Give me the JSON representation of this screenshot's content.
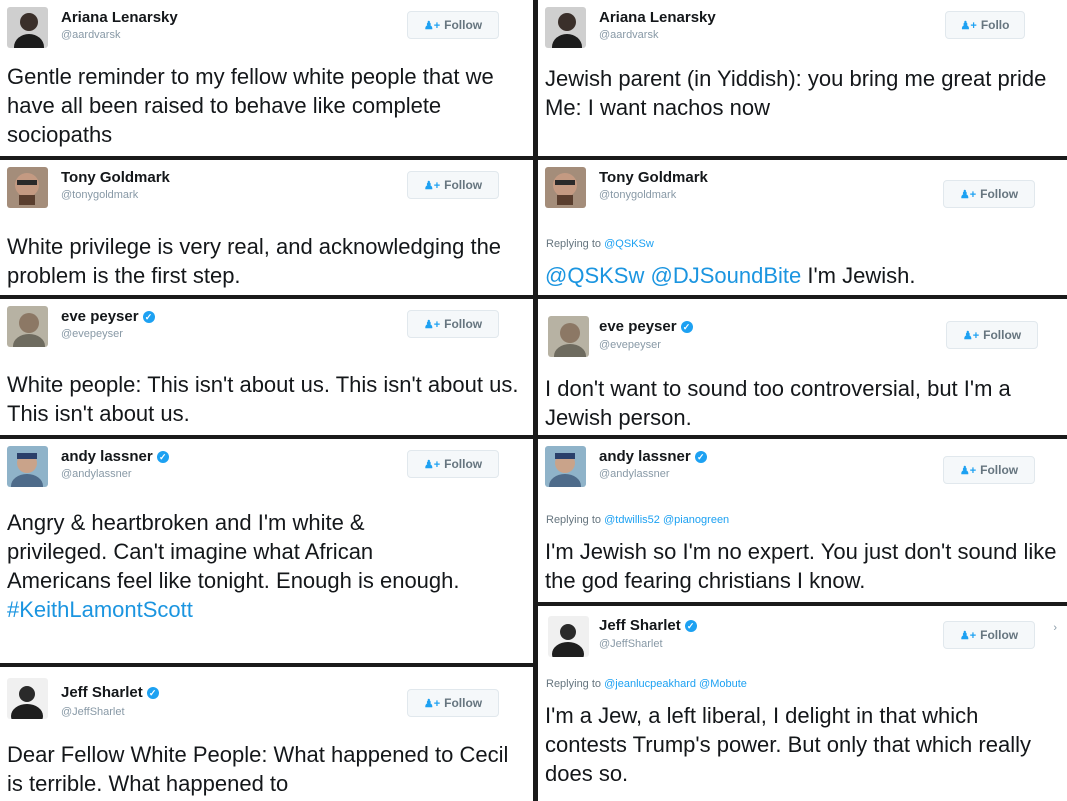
{
  "follow_label": "Follow",
  "reply_prefix": "Replying to",
  "left": [
    {
      "name": "Ariana Lenarsky",
      "handle": "@aardvarsk",
      "verified": false,
      "text": "Gentle reminder to my fellow white people that we have all been raised to behave like complete sociopaths"
    },
    {
      "name": "Tony Goldmark",
      "handle": "@tonygoldmark",
      "verified": false,
      "text": "White privilege is very real, and acknowledging the problem is the first step."
    },
    {
      "name": "eve peyser",
      "handle": "@evepeyser",
      "verified": true,
      "text": "White people: This isn't about us. This isn't about us. This isn't about us."
    },
    {
      "name": "andy lassner",
      "handle": "@andylassner",
      "verified": true,
      "text": "Angry & heartbroken and I'm white & privileged. Can't imagine what African Americans feel like tonight. Enough is enough.",
      "hashtag": "#KeithLamontScott"
    },
    {
      "name": "Jeff Sharlet",
      "handle": "@JeffSharlet",
      "verified": true,
      "text": "Dear Fellow White People: What happened to Cecil is terrible. What happened to"
    }
  ],
  "right": [
    {
      "name": "Ariana Lenarsky",
      "handle": "@aardvarsk",
      "verified": false,
      "text": "Jewish parent (in Yiddish): you bring me great pride\nMe: I want nachos now",
      "follow_label": "Follo"
    },
    {
      "name": "Tony Goldmark",
      "handle": "@tonygoldmark",
      "verified": false,
      "reply_to": "@QSKSw",
      "mention_1": "@QSKSw",
      "mention_2": "@DJSoundBite",
      "text": " I'm Jewish."
    },
    {
      "name": "eve peyser",
      "handle": "@evepeyser",
      "verified": true,
      "text": "I don't want to sound too controversial, but I'm a Jewish person."
    },
    {
      "name": "andy lassner",
      "handle": "@andylassner",
      "verified": true,
      "reply_to": "@tdwillis52 @pianogreen",
      "text": "I'm Jewish so I'm no expert. You just don't sound like the god fearing christians I know."
    },
    {
      "name": "Jeff Sharlet",
      "handle": "@JeffSharlet",
      "verified": true,
      "reply_to": "@jeanlucpeakhard @Mobute",
      "text": "I'm a Jew, a left liberal, I delight in that which contests Trump's power. But only that which really does so."
    }
  ]
}
